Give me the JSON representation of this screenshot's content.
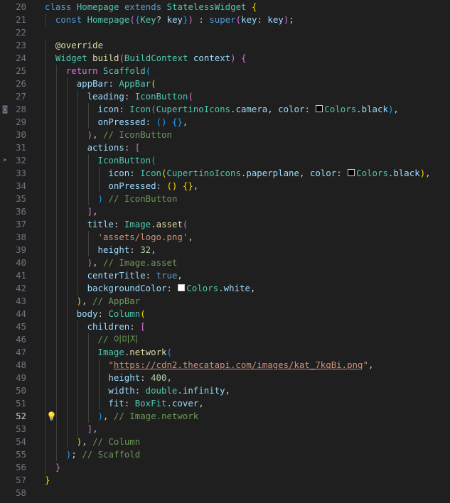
{
  "editor": {
    "active_line": 52,
    "gutter_glyphs": [
      {
        "line": 28,
        "icon": "camera-icon",
        "glyph": "◙"
      },
      {
        "line": 32,
        "icon": "paperplane-icon",
        "glyph": "➤"
      },
      {
        "line": 52,
        "icon": "lightbulb-icon",
        "glyph": "💡"
      }
    ],
    "colors": {
      "background": "#1f1f1f",
      "keyword": "#569cd6",
      "class": "#4ec9b0",
      "function": "#dcdcaa",
      "property": "#9cdcfe",
      "string": "#ce9178",
      "number": "#b5cea8",
      "comment": "#6a9955"
    },
    "lines": [
      {
        "n": "20",
        "indent": 0,
        "tokens": [
          [
            "k",
            "class"
          ],
          [
            "plain",
            " "
          ],
          [
            "cls",
            "Homepage"
          ],
          [
            "plain",
            " "
          ],
          [
            "k",
            "extends"
          ],
          [
            "plain",
            " "
          ],
          [
            "cls",
            "StatelessWidget"
          ],
          [
            "plain",
            " "
          ],
          [
            "br1",
            "{"
          ]
        ]
      },
      {
        "n": "21",
        "indent": 1,
        "tokens": [
          [
            "k",
            "const"
          ],
          [
            "plain",
            " "
          ],
          [
            "cls",
            "Homepage"
          ],
          [
            "br2",
            "("
          ],
          [
            "br3",
            "{"
          ],
          [
            "cls",
            "Key"
          ],
          [
            "plain",
            "? "
          ],
          [
            "prm",
            "key"
          ],
          [
            "br3",
            "}"
          ],
          [
            "br2",
            ")"
          ],
          [
            "plain",
            " : "
          ],
          [
            "k",
            "super"
          ],
          [
            "br2",
            "("
          ],
          [
            "prm",
            "key"
          ],
          [
            "plain",
            ": "
          ],
          [
            "prm",
            "key"
          ],
          [
            "br2",
            ")"
          ],
          [
            "plain",
            ";"
          ]
        ]
      },
      {
        "n": "22",
        "indent": 0,
        "tokens": []
      },
      {
        "n": "23",
        "indent": 1,
        "tokens": [
          [
            "fn",
            "@override"
          ]
        ]
      },
      {
        "n": "24",
        "indent": 1,
        "tokens": [
          [
            "cls",
            "Widget"
          ],
          [
            "plain",
            " "
          ],
          [
            "fn",
            "build"
          ],
          [
            "br2",
            "("
          ],
          [
            "cls",
            "BuildContext"
          ],
          [
            "plain",
            " "
          ],
          [
            "prm",
            "context"
          ],
          [
            "br2",
            ")"
          ],
          [
            "plain",
            " "
          ],
          [
            "br2",
            "{"
          ]
        ]
      },
      {
        "n": "25",
        "indent": 2,
        "tokens": [
          [
            "br2",
            "return"
          ],
          [
            "plain",
            " "
          ],
          [
            "cls",
            "Scaffold"
          ],
          [
            "br3",
            "("
          ]
        ]
      },
      {
        "n": "26",
        "indent": 3,
        "tokens": [
          [
            "prm",
            "appBar"
          ],
          [
            "plain",
            ": "
          ],
          [
            "cls",
            "AppBar"
          ],
          [
            "br1",
            "("
          ]
        ]
      },
      {
        "n": "27",
        "indent": 4,
        "tokens": [
          [
            "prm",
            "leading"
          ],
          [
            "plain",
            ": "
          ],
          [
            "cls",
            "IconButton"
          ],
          [
            "br2",
            "("
          ]
        ]
      },
      {
        "n": "28",
        "indent": 5,
        "tokens": [
          [
            "prm",
            "icon"
          ],
          [
            "plain",
            ": "
          ],
          [
            "cls",
            "Icon"
          ],
          [
            "br3",
            "("
          ],
          [
            "cls",
            "CupertinoIcons"
          ],
          [
            "plain",
            "."
          ],
          [
            "prm",
            "camera"
          ],
          [
            "plain",
            ", "
          ],
          [
            "prm",
            "color"
          ],
          [
            "plain",
            ": "
          ],
          [
            "swatch_black",
            ""
          ],
          [
            "cls",
            "Colors"
          ],
          [
            "plain",
            "."
          ],
          [
            "prm",
            "black"
          ],
          [
            "br3",
            ")"
          ],
          [
            "plain",
            ","
          ]
        ]
      },
      {
        "n": "29",
        "indent": 5,
        "tokens": [
          [
            "prm",
            "onPressed"
          ],
          [
            "plain",
            ": "
          ],
          [
            "br3",
            "()"
          ],
          [
            "plain",
            " "
          ],
          [
            "br3",
            "{}"
          ],
          [
            "plain",
            ","
          ]
        ]
      },
      {
        "n": "30",
        "indent": 4,
        "tokens": [
          [
            "br2",
            ")"
          ],
          [
            "plain",
            ", "
          ],
          [
            "cmt",
            "// IconButton"
          ]
        ]
      },
      {
        "n": "31",
        "indent": 4,
        "tokens": [
          [
            "prm",
            "actions"
          ],
          [
            "plain",
            ": "
          ],
          [
            "br2",
            "["
          ]
        ]
      },
      {
        "n": "32",
        "indent": 5,
        "tokens": [
          [
            "cls",
            "IconButton"
          ],
          [
            "br3",
            "("
          ]
        ]
      },
      {
        "n": "33",
        "indent": 6,
        "tokens": [
          [
            "prm",
            "icon"
          ],
          [
            "plain",
            ": "
          ],
          [
            "cls",
            "Icon"
          ],
          [
            "br1",
            "("
          ],
          [
            "cls",
            "CupertinoIcons"
          ],
          [
            "plain",
            "."
          ],
          [
            "prm",
            "paperplane"
          ],
          [
            "plain",
            ", "
          ],
          [
            "prm",
            "color"
          ],
          [
            "plain",
            ": "
          ],
          [
            "swatch_black",
            ""
          ],
          [
            "cls",
            "Colors"
          ],
          [
            "plain",
            "."
          ],
          [
            "prm",
            "black"
          ],
          [
            "br1",
            ")"
          ],
          [
            "plain",
            ","
          ]
        ]
      },
      {
        "n": "34",
        "indent": 6,
        "tokens": [
          [
            "prm",
            "onPressed"
          ],
          [
            "plain",
            ": "
          ],
          [
            "br1",
            "()"
          ],
          [
            "plain",
            " "
          ],
          [
            "br1",
            "{}"
          ],
          [
            "plain",
            ","
          ]
        ]
      },
      {
        "n": "35",
        "indent": 5,
        "tokens": [
          [
            "br3",
            ")"
          ],
          [
            "plain",
            " "
          ],
          [
            "cmt",
            "// IconButton"
          ]
        ]
      },
      {
        "n": "36",
        "indent": 4,
        "tokens": [
          [
            "br2",
            "]"
          ],
          [
            "plain",
            ","
          ]
        ]
      },
      {
        "n": "37",
        "indent": 4,
        "tokens": [
          [
            "prm",
            "title"
          ],
          [
            "plain",
            ": "
          ],
          [
            "cls",
            "Image"
          ],
          [
            "plain",
            "."
          ],
          [
            "fn",
            "asset"
          ],
          [
            "br2",
            "("
          ]
        ]
      },
      {
        "n": "38",
        "indent": 5,
        "tokens": [
          [
            "str",
            "'assets/logo.png'"
          ],
          [
            "plain",
            ","
          ]
        ]
      },
      {
        "n": "39",
        "indent": 5,
        "tokens": [
          [
            "prm",
            "height"
          ],
          [
            "plain",
            ": "
          ],
          [
            "num",
            "32"
          ],
          [
            "plain",
            ","
          ]
        ]
      },
      {
        "n": "40",
        "indent": 4,
        "tokens": [
          [
            "br2",
            ")"
          ],
          [
            "plain",
            ", "
          ],
          [
            "cmt",
            "// Image.asset"
          ]
        ]
      },
      {
        "n": "41",
        "indent": 4,
        "tokens": [
          [
            "prm",
            "centerTitle"
          ],
          [
            "plain",
            ": "
          ],
          [
            "k",
            "true"
          ],
          [
            "plain",
            ","
          ]
        ]
      },
      {
        "n": "42",
        "indent": 4,
        "tokens": [
          [
            "prm",
            "backgroundColor"
          ],
          [
            "plain",
            ": "
          ],
          [
            "swatch_white",
            ""
          ],
          [
            "cls",
            "Colors"
          ],
          [
            "plain",
            "."
          ],
          [
            "prm",
            "white"
          ],
          [
            "plain",
            ","
          ]
        ]
      },
      {
        "n": "43",
        "indent": 3,
        "tokens": [
          [
            "br1",
            ")"
          ],
          [
            "plain",
            ", "
          ],
          [
            "cmt",
            "// AppBar"
          ]
        ]
      },
      {
        "n": "44",
        "indent": 3,
        "tokens": [
          [
            "prm",
            "body"
          ],
          [
            "plain",
            ": "
          ],
          [
            "cls",
            "Column"
          ],
          [
            "br1",
            "("
          ]
        ]
      },
      {
        "n": "45",
        "indent": 4,
        "tokens": [
          [
            "prm",
            "children"
          ],
          [
            "plain",
            ": "
          ],
          [
            "br2",
            "["
          ]
        ]
      },
      {
        "n": "46",
        "indent": 5,
        "tokens": [
          [
            "cmt",
            "// 이미지"
          ]
        ]
      },
      {
        "n": "47",
        "indent": 5,
        "tokens": [
          [
            "cls",
            "Image"
          ],
          [
            "plain",
            "."
          ],
          [
            "fn",
            "network"
          ],
          [
            "br3",
            "("
          ]
        ]
      },
      {
        "n": "48",
        "indent": 6,
        "tokens": [
          [
            "str",
            "\""
          ],
          [
            "str_url",
            "https://cdn2.thecatapi.com/images/kat_7kqBi.png"
          ],
          [
            "str",
            "\""
          ],
          [
            "plain",
            ","
          ]
        ]
      },
      {
        "n": "49",
        "indent": 6,
        "tokens": [
          [
            "prm",
            "height"
          ],
          [
            "plain",
            ": "
          ],
          [
            "num",
            "400"
          ],
          [
            "plain",
            ","
          ]
        ]
      },
      {
        "n": "50",
        "indent": 6,
        "tokens": [
          [
            "prm",
            "width"
          ],
          [
            "plain",
            ": "
          ],
          [
            "cls",
            "double"
          ],
          [
            "plain",
            "."
          ],
          [
            "prm",
            "infinity"
          ],
          [
            "plain",
            ","
          ]
        ]
      },
      {
        "n": "51",
        "indent": 6,
        "tokens": [
          [
            "prm",
            "fit"
          ],
          [
            "plain",
            ": "
          ],
          [
            "cls",
            "BoxFit"
          ],
          [
            "plain",
            "."
          ],
          [
            "prm",
            "cover"
          ],
          [
            "plain",
            ","
          ]
        ]
      },
      {
        "n": "52",
        "indent": 5,
        "tokens": [
          [
            "br3",
            ")"
          ],
          [
            "plain",
            ", "
          ],
          [
            "cmt",
            "// Image.network"
          ]
        ]
      },
      {
        "n": "53",
        "indent": 4,
        "tokens": [
          [
            "br2",
            "]"
          ],
          [
            "plain",
            ","
          ]
        ]
      },
      {
        "n": "54",
        "indent": 3,
        "tokens": [
          [
            "br1",
            ")"
          ],
          [
            "plain",
            ", "
          ],
          [
            "cmt",
            "// Column"
          ]
        ]
      },
      {
        "n": "55",
        "indent": 2,
        "tokens": [
          [
            "br3",
            ")"
          ],
          [
            "plain",
            "; "
          ],
          [
            "cmt",
            "// Scaffold"
          ]
        ]
      },
      {
        "n": "56",
        "indent": 1,
        "tokens": [
          [
            "br2",
            "}"
          ]
        ]
      },
      {
        "n": "57",
        "indent": 0,
        "tokens": [
          [
            "br1",
            "}"
          ]
        ]
      },
      {
        "n": "58",
        "indent": 0,
        "tokens": []
      }
    ]
  }
}
